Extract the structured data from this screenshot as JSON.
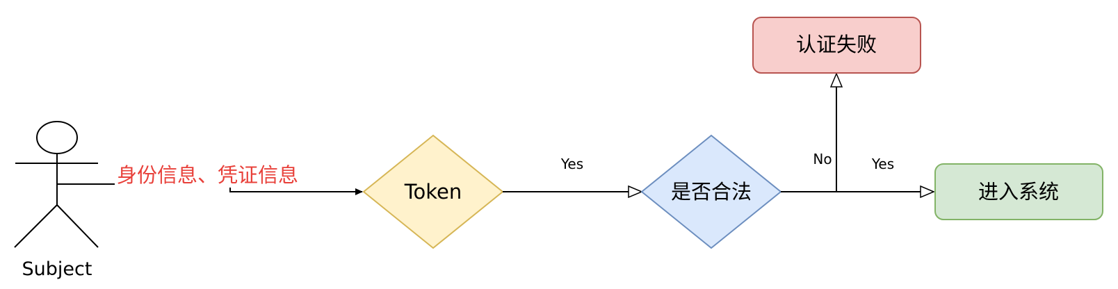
{
  "actor": {
    "label": "Subject"
  },
  "flow": {
    "credentials_label": "身份信息、凭证信息",
    "token_label": "Token",
    "yes_label_1": "Yes",
    "check_label": "是否合法",
    "no_label": "No",
    "yes_label_2": "Yes",
    "fail_label": "认证失败",
    "enter_label": "进入系统"
  },
  "colors": {
    "token_fill": "#fff2cc",
    "token_stroke": "#d6b656",
    "check_fill": "#dae8fc",
    "check_stroke": "#6c8ebf",
    "fail_fill": "#f8cecc",
    "fail_stroke": "#b85450",
    "enter_fill": "#d5e8d4",
    "enter_stroke": "#82b366",
    "credentials_text": "#e8403a"
  }
}
